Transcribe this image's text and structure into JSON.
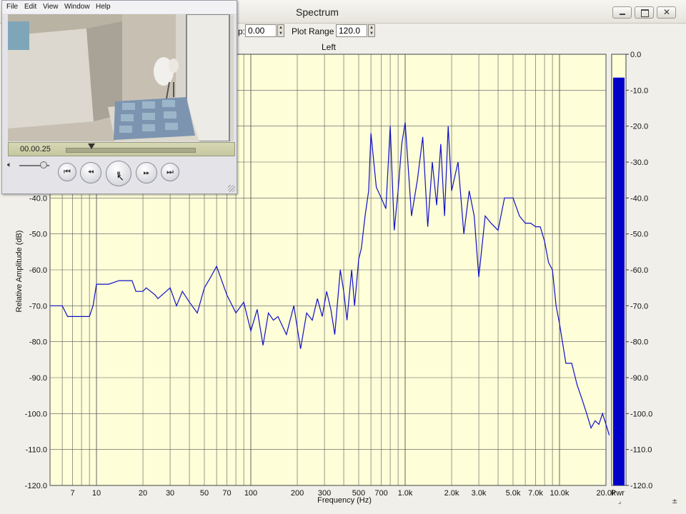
{
  "window": {
    "title": "Spectrum"
  },
  "toolbar": {
    "fields": [
      {
        "label": "p:",
        "value": "0.00"
      },
      {
        "label": "Plot Range",
        "value": "120.0"
      }
    ]
  },
  "channel": {
    "label": "Left"
  },
  "chart_data": {
    "type": "line",
    "title": "",
    "xlabel": "Frequency (Hz)",
    "ylabel": "Relative Amplitude (dB)",
    "x_scale": "log",
    "xlim": [
      5,
      20000
    ],
    "ylim": [
      -120,
      0
    ],
    "x_ticks": [
      7,
      10,
      20,
      30,
      50,
      70,
      100,
      200,
      300,
      500,
      700,
      1000,
      2000,
      3000,
      5000,
      7000,
      10000,
      20000
    ],
    "x_tick_labels": [
      "7",
      "10",
      "20",
      "30",
      "50",
      "70",
      "100",
      "200",
      "300",
      "500",
      "700",
      "1.0k",
      "2.0k",
      "3.0k",
      "5.0k",
      "7.0k",
      "10.0k",
      "20.0k"
    ],
    "y_ticks": [
      -40,
      -50,
      -60,
      -70,
      -80,
      -90,
      -100,
      -110,
      -120
    ],
    "y_tick_labels": [
      "-40.0",
      "-50.0",
      "-60.0",
      "-70.0",
      "-80.0",
      "-90.0",
      "-100.0",
      "-110.0",
      "-120.0"
    ],
    "grid": true,
    "line_color": "#1010c8",
    "plot_background": "#fefed9",
    "series": [
      {
        "x": [
          5,
          6,
          6.5,
          8,
          9,
          9.5,
          10,
          12,
          14,
          17,
          18,
          20,
          21,
          24,
          25,
          30,
          33,
          36,
          40,
          45,
          50,
          55,
          60,
          70,
          80,
          90,
          100,
          110,
          120,
          130,
          140,
          150,
          170,
          190,
          210,
          230,
          250,
          270,
          290,
          310,
          330,
          350,
          380,
          400,
          420,
          450,
          470,
          500,
          520,
          550,
          580,
          600,
          650,
          700,
          750,
          800,
          850,
          900,
          950,
          1000,
          1100,
          1200,
          1300,
          1400,
          1500,
          1600,
          1700,
          1800,
          1900,
          2000,
          2200,
          2400,
          2600,
          2800,
          3000,
          3300,
          3600,
          4000,
          4400,
          5000,
          5500,
          6000,
          6500,
          7000,
          7500,
          8000,
          8500,
          9000,
          9500,
          10000,
          11000,
          12000,
          13000,
          14000,
          15000,
          16000,
          17000,
          18000,
          19000,
          20000,
          21000
        ],
        "y": [
          -70,
          -70,
          -73,
          -73,
          -73,
          -70,
          -64,
          -64,
          -63,
          -63,
          -66,
          -66,
          -65,
          -67,
          -68,
          -65,
          -70,
          -66,
          -69,
          -72,
          -65,
          -62,
          -59,
          -67,
          -72,
          -69,
          -77,
          -71,
          -81,
          -72,
          -74,
          -73,
          -78,
          -70,
          -82,
          -72,
          -74,
          -68,
          -73,
          -66,
          -71,
          -78,
          -60,
          -66,
          -74,
          -60,
          -70,
          -57,
          -54,
          -45,
          -38,
          -22,
          -37,
          -40,
          -43,
          -20,
          -49,
          -38,
          -25,
          -19,
          -45,
          -35,
          -23,
          -48,
          -30,
          -42,
          -25,
          -45,
          -20,
          -38,
          -30,
          -50,
          -38,
          -45,
          -62,
          -45,
          -47,
          -49,
          -40,
          -40,
          -45,
          -47,
          -47,
          -48,
          -48,
          -52,
          -58,
          -60,
          -70,
          -75,
          -86,
          -86,
          -92,
          -96,
          -100,
          -104,
          -102,
          -103,
          -100,
          -103,
          -106
        ]
      }
    ]
  },
  "meter": {
    "ticks": [
      "0.0",
      "-10.0",
      "-20.0",
      "-30.0",
      "-40.0",
      "-50.0",
      "-60.0",
      "-70.0",
      "-80.0",
      "-90.0",
      "-100.0",
      "-110.0",
      "-120.0"
    ],
    "level_db": -6.5,
    "label": "Pwr",
    "bar_color": "#0000c8"
  },
  "player": {
    "menu": [
      "File",
      "Edit",
      "View",
      "Window",
      "Help"
    ],
    "time": "00.00.25",
    "position_fraction": 0.2,
    "volume_fraction": 0.8,
    "controls": [
      "skip-back-icon",
      "rewind-icon",
      "pause-icon",
      "fast-forward-icon",
      "skip-forward-icon"
    ]
  }
}
